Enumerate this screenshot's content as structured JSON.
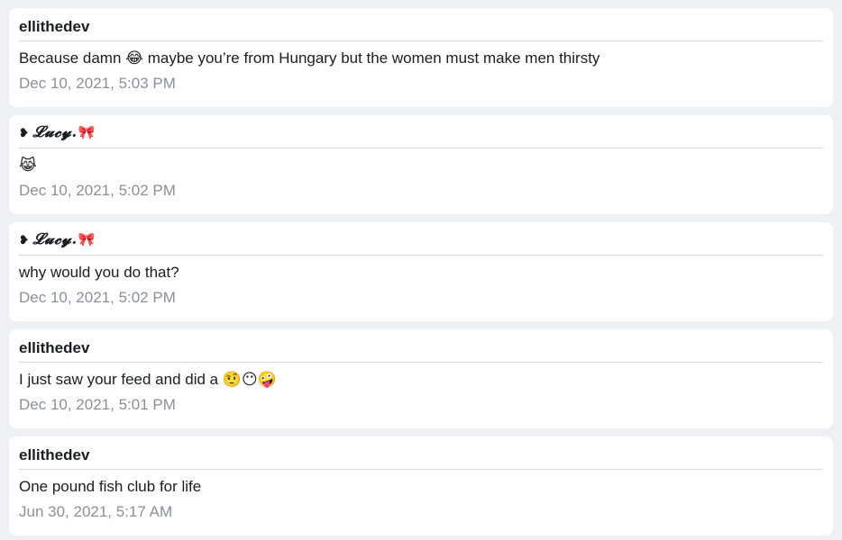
{
  "messages": [
    {
      "author": "ellithedev",
      "text": "Because damn 😂 maybe you’re from Hungary but the women must make men thirsty",
      "time": "Dec 10, 2021, 5:03 PM"
    },
    {
      "author_prefix": "❥",
      "author": "𝓛𝓾𝓬𝔂.",
      "author_suffix": "🎀",
      "text": "😹",
      "time": "Dec 10, 2021, 5:02 PM"
    },
    {
      "author_prefix": "❥",
      "author": "𝓛𝓾𝓬𝔂.",
      "author_suffix": "🎀",
      "text": "why would you do that?",
      "time": "Dec 10, 2021, 5:02 PM"
    },
    {
      "author": "ellithedev",
      "text": "I just saw your feed and did a 🤨😶🤪",
      "time": "Dec 10, 2021, 5:01 PM"
    },
    {
      "author": "ellithedev",
      "text": "One pound fish club for life",
      "time": "Jun 30, 2021, 5:17 AM"
    }
  ]
}
